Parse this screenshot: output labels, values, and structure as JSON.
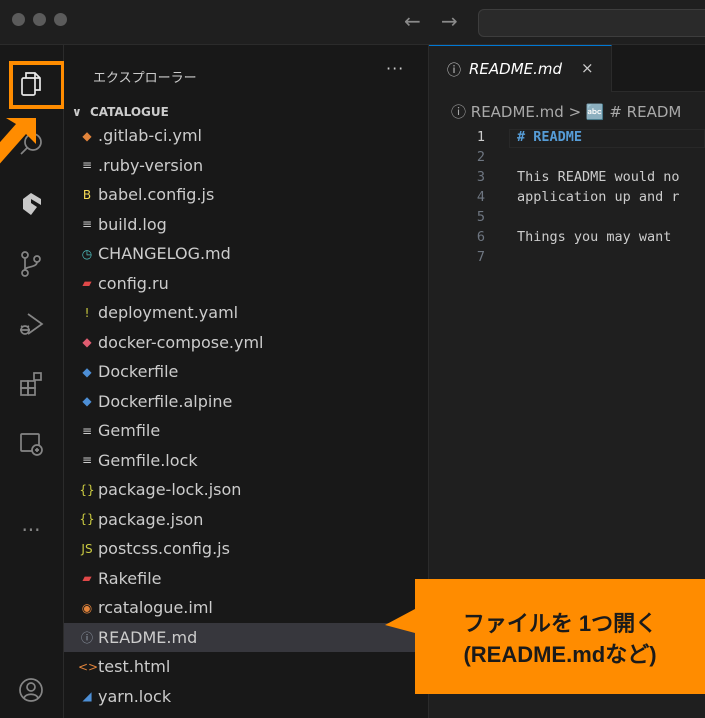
{
  "window": {
    "traffic_lights": [
      "close",
      "minimize",
      "zoom"
    ]
  },
  "navigation": {
    "back": "←",
    "forward": "→"
  },
  "activity_bar": {
    "items": [
      "files-icon",
      "search-icon",
      "gitlab-icon",
      "source-control-icon",
      "run-debug-icon",
      "extensions-icon",
      "remote-explorer-icon",
      "more-icon",
      "account-icon"
    ],
    "more": "..."
  },
  "explorer": {
    "title": "エクスプローラー",
    "more": "···",
    "section": "CATALOGUE",
    "files": [
      {
        "name": ".gitlab-ci.yml",
        "icon": "gitlab-icon",
        "glyph": "◆",
        "color": "#e2843b"
      },
      {
        "name": ".ruby-version",
        "icon": "lines-icon",
        "glyph": "≡",
        "color": "#cccccc"
      },
      {
        "name": "babel.config.js",
        "icon": "babel-icon",
        "glyph": "B",
        "color": "#f5da55"
      },
      {
        "name": "build.log",
        "icon": "lines-icon",
        "glyph": "≡",
        "color": "#cccccc"
      },
      {
        "name": "CHANGELOG.md",
        "icon": "clock-icon",
        "glyph": "◷",
        "color": "#4fc1c1"
      },
      {
        "name": "config.ru",
        "icon": "ruby-icon",
        "glyph": "▰",
        "color": "#e04848"
      },
      {
        "name": "deployment.yaml",
        "icon": "yaml-icon",
        "glyph": "!",
        "color": "#cbcb41"
      },
      {
        "name": "docker-compose.yml",
        "icon": "docker-icon",
        "glyph": "◆",
        "color": "#e05d71"
      },
      {
        "name": "Dockerfile",
        "icon": "docker-icon",
        "glyph": "◆",
        "color": "#4d8fd6"
      },
      {
        "name": "Dockerfile.alpine",
        "icon": "docker-icon",
        "glyph": "◆",
        "color": "#4d8fd6"
      },
      {
        "name": "Gemfile",
        "icon": "lines-icon",
        "glyph": "≡",
        "color": "#cccccc"
      },
      {
        "name": "Gemfile.lock",
        "icon": "lines-icon",
        "glyph": "≡",
        "color": "#cccccc"
      },
      {
        "name": "package-lock.json",
        "icon": "json-icon",
        "glyph": "{}",
        "color": "#cbcb41"
      },
      {
        "name": "package.json",
        "icon": "json-icon",
        "glyph": "{}",
        "color": "#cbcb41"
      },
      {
        "name": "postcss.config.js",
        "icon": "js-icon",
        "glyph": "JS",
        "color": "#cbcb41"
      },
      {
        "name": "Rakefile",
        "icon": "ruby-icon",
        "glyph": "▰",
        "color": "#e04848"
      },
      {
        "name": "rcatalogue.iml",
        "icon": "rss-icon",
        "glyph": "◉",
        "color": "#e2843b"
      },
      {
        "name": "README.md",
        "icon": "info-icon",
        "glyph": "ⓘ",
        "color": "#9aa4b2"
      },
      {
        "name": "test.html",
        "icon": "html-icon",
        "glyph": "<>",
        "color": "#e2843b"
      },
      {
        "name": "yarn.lock",
        "icon": "yarn-icon",
        "glyph": "◢",
        "color": "#4d8fd6"
      }
    ],
    "selected_index": 17
  },
  "editor": {
    "tab": {
      "info": "ⓘ",
      "label": "README.md",
      "close": "×"
    },
    "breadcrumb": "ⓘ README.md > 🔤 # READM",
    "lines": [
      {
        "number": "1",
        "text": "# README"
      },
      {
        "number": "2",
        "text": ""
      },
      {
        "number": "3",
        "text": "This README would no"
      },
      {
        "number": "4",
        "text": "application up and r"
      },
      {
        "number": "5",
        "text": ""
      },
      {
        "number": "6",
        "text": "Things you may want"
      },
      {
        "number": "7",
        "text": ""
      }
    ]
  },
  "annotation": {
    "callout_line1": "ファイルを 1つ開く",
    "callout_line2": "(README.mdなど)",
    "highlight_color": "#ff8c00"
  }
}
